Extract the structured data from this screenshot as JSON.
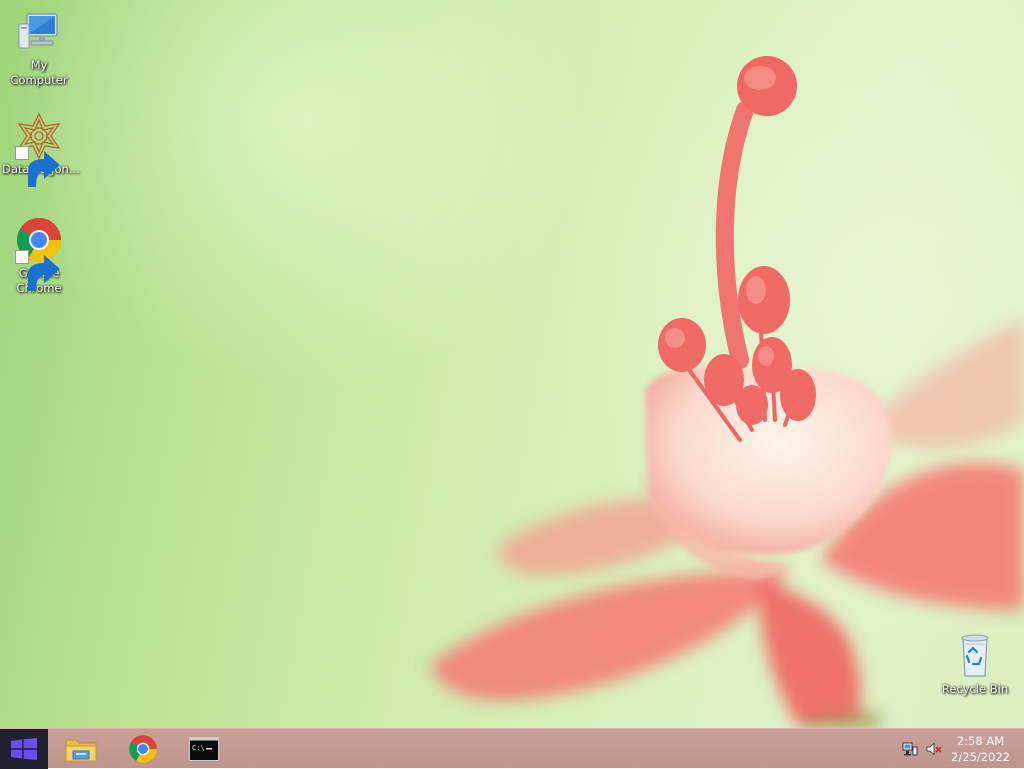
{
  "desktop": {
    "icons": [
      {
        "label": "My Computer",
        "icon": "computer-icon"
      },
      {
        "label": "DataWagon...",
        "icon": "datawagon-icon"
      },
      {
        "label": "Google Chrome",
        "icon": "chrome-icon"
      },
      {
        "label": "Recycle Bin",
        "icon": "recycle-bin-icon"
      }
    ]
  },
  "taskbar": {
    "start_icon": "windows-logo-icon",
    "pinned": [
      {
        "name": "File Explorer",
        "icon": "folder-icon"
      },
      {
        "name": "Google Chrome",
        "icon": "chrome-icon"
      },
      {
        "name": "Command Prompt",
        "icon": "cmd-icon"
      }
    ],
    "tray": {
      "icons": [
        "network-icon",
        "volume-muted-icon"
      ],
      "time": "2:58 AM",
      "date": "2/25/2022"
    }
  },
  "colors": {
    "taskbar": "#c39b94",
    "start_button": "#1f1f2e",
    "windows_logo": "#6a4cf0",
    "flower": "#f27a78"
  }
}
